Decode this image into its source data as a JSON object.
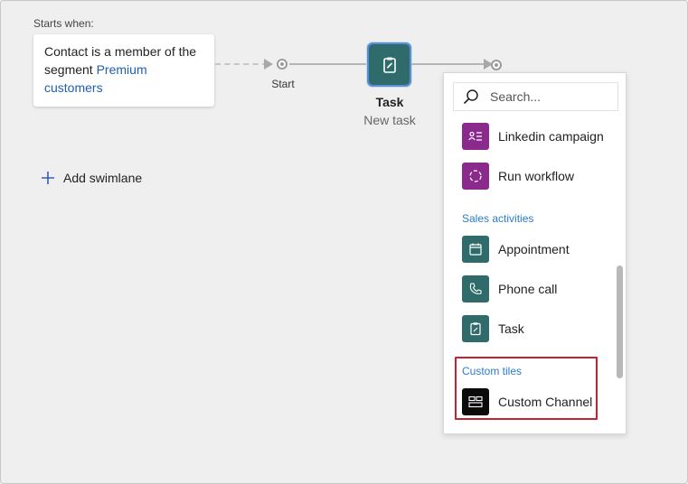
{
  "canvas": {
    "starts_when_label": "Starts when:",
    "trigger_text": "Contact is a member of the segment ",
    "segment_link": "Premium customers",
    "start_label": "Start",
    "task_title": "Task",
    "task_subtitle": "New task",
    "add_swimlane_label": "Add swimlane"
  },
  "panel": {
    "search_placeholder": "Search...",
    "items_top": [
      {
        "label": "Linkedin campaign",
        "icon": "linkedin-campaign-icon",
        "color": "#8a2a8c"
      },
      {
        "label": "Run workflow",
        "icon": "run-workflow-icon",
        "color": "#8a2a8c"
      }
    ],
    "sales_header": "Sales activities",
    "sales_items": [
      {
        "label": "Appointment",
        "icon": "appointment-icon",
        "color": "#2f6b6a"
      },
      {
        "label": "Phone call",
        "icon": "phone-call-icon",
        "color": "#2f6b6a"
      },
      {
        "label": "Task",
        "icon": "task-icon",
        "color": "#2f6b6a"
      }
    ],
    "custom_header": "Custom tiles",
    "custom_items": [
      {
        "label": "Custom Channel",
        "icon": "custom-channel-icon",
        "color": "#0b0b0b"
      }
    ]
  },
  "colors": {
    "accent_link": "#1f5fae",
    "section_header": "#2b7cc8",
    "highlight": "#c8202e",
    "tile_teal": "#2f6b6a",
    "tile_purple": "#8a2a8c"
  }
}
